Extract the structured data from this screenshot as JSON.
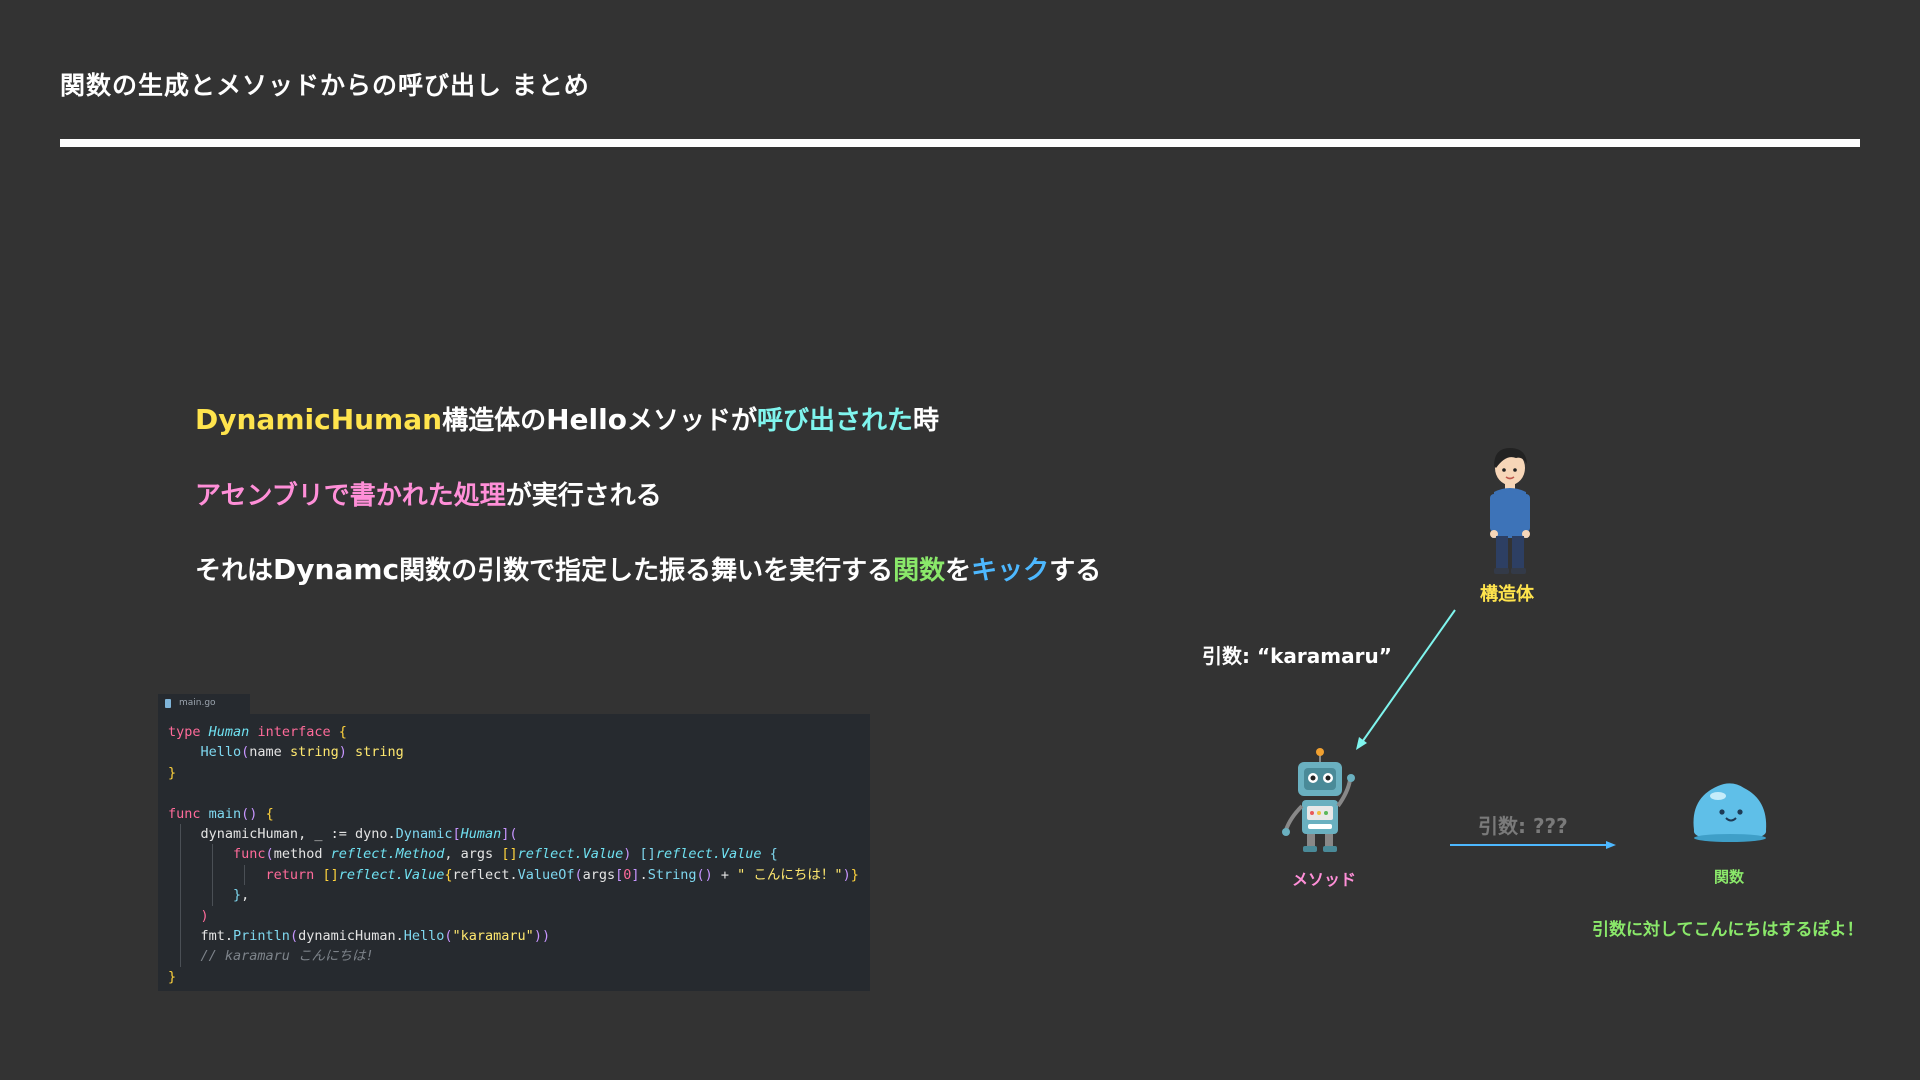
{
  "title": "関数の生成とメソッドからの呼び出し まとめ",
  "colors": {
    "background": "#333333",
    "yellow": "#ffe44d",
    "cyan": "#7ff5ee",
    "pink": "#ff8fd8",
    "green": "#8ae86a",
    "blue": "#4db8ff"
  },
  "summary": {
    "line1": {
      "dynamic_human": "DynamicHuman",
      "part2": "構造体の",
      "hello": "Hello",
      "part4": "メソッドが",
      "called": "呼び出された",
      "part6": "時"
    },
    "line2": {
      "assembly": "アセンブリで書かれた処理",
      "part2": "が実行される"
    },
    "line3": {
      "part1": "それは",
      "dynamc": "Dynamc",
      "part3": "関数の引数で指定した振る舞いを実行する",
      "func": "関数",
      "part5": "を",
      "kick": "キック",
      "part7": "する"
    }
  },
  "code": {
    "filename": "main.go",
    "t_type": "type",
    "t_human": "Human",
    "t_interface": "interface",
    "t_hello": "Hello",
    "t_name": "name",
    "t_string": "string",
    "t_func": "func",
    "t_main": "main",
    "t_dynamic_human_var": "dynamicHuman",
    "t_assign": ", _ := dyno.",
    "t_dynamic_fn": "Dynamic",
    "t_method": "method",
    "t_reflect_method": "reflect.Method",
    "t_args": "args",
    "t_reflect_value": "reflect.Value",
    "t_return": "return",
    "t_valueof_prefix": "reflect.",
    "t_valueof": "ValueOf",
    "t_args_idx_prefix": "args",
    "t_zero": "0",
    "t_string_call": "String",
    "t_plus": "+",
    "t_konnichiwa": "\" こんにちは！\"",
    "t_fmt": "fmt.",
    "t_println": "Println",
    "t_dh_hello_prefix": "dynamicHuman.",
    "t_karamaru": "\"karamaru\"",
    "t_comment": "// karamaru こんにちは!"
  },
  "diagram": {
    "human_label": "構造体",
    "human_icon": "person-icon",
    "arg_label": "引数:  “karamaru”",
    "method_label": "メソッド",
    "method_icon": "robot-icon",
    "arg2_label": "引数: ???",
    "func_label": "関数",
    "func_icon": "slime-icon",
    "note": "引数に対してこんにちはするぽよ！"
  }
}
